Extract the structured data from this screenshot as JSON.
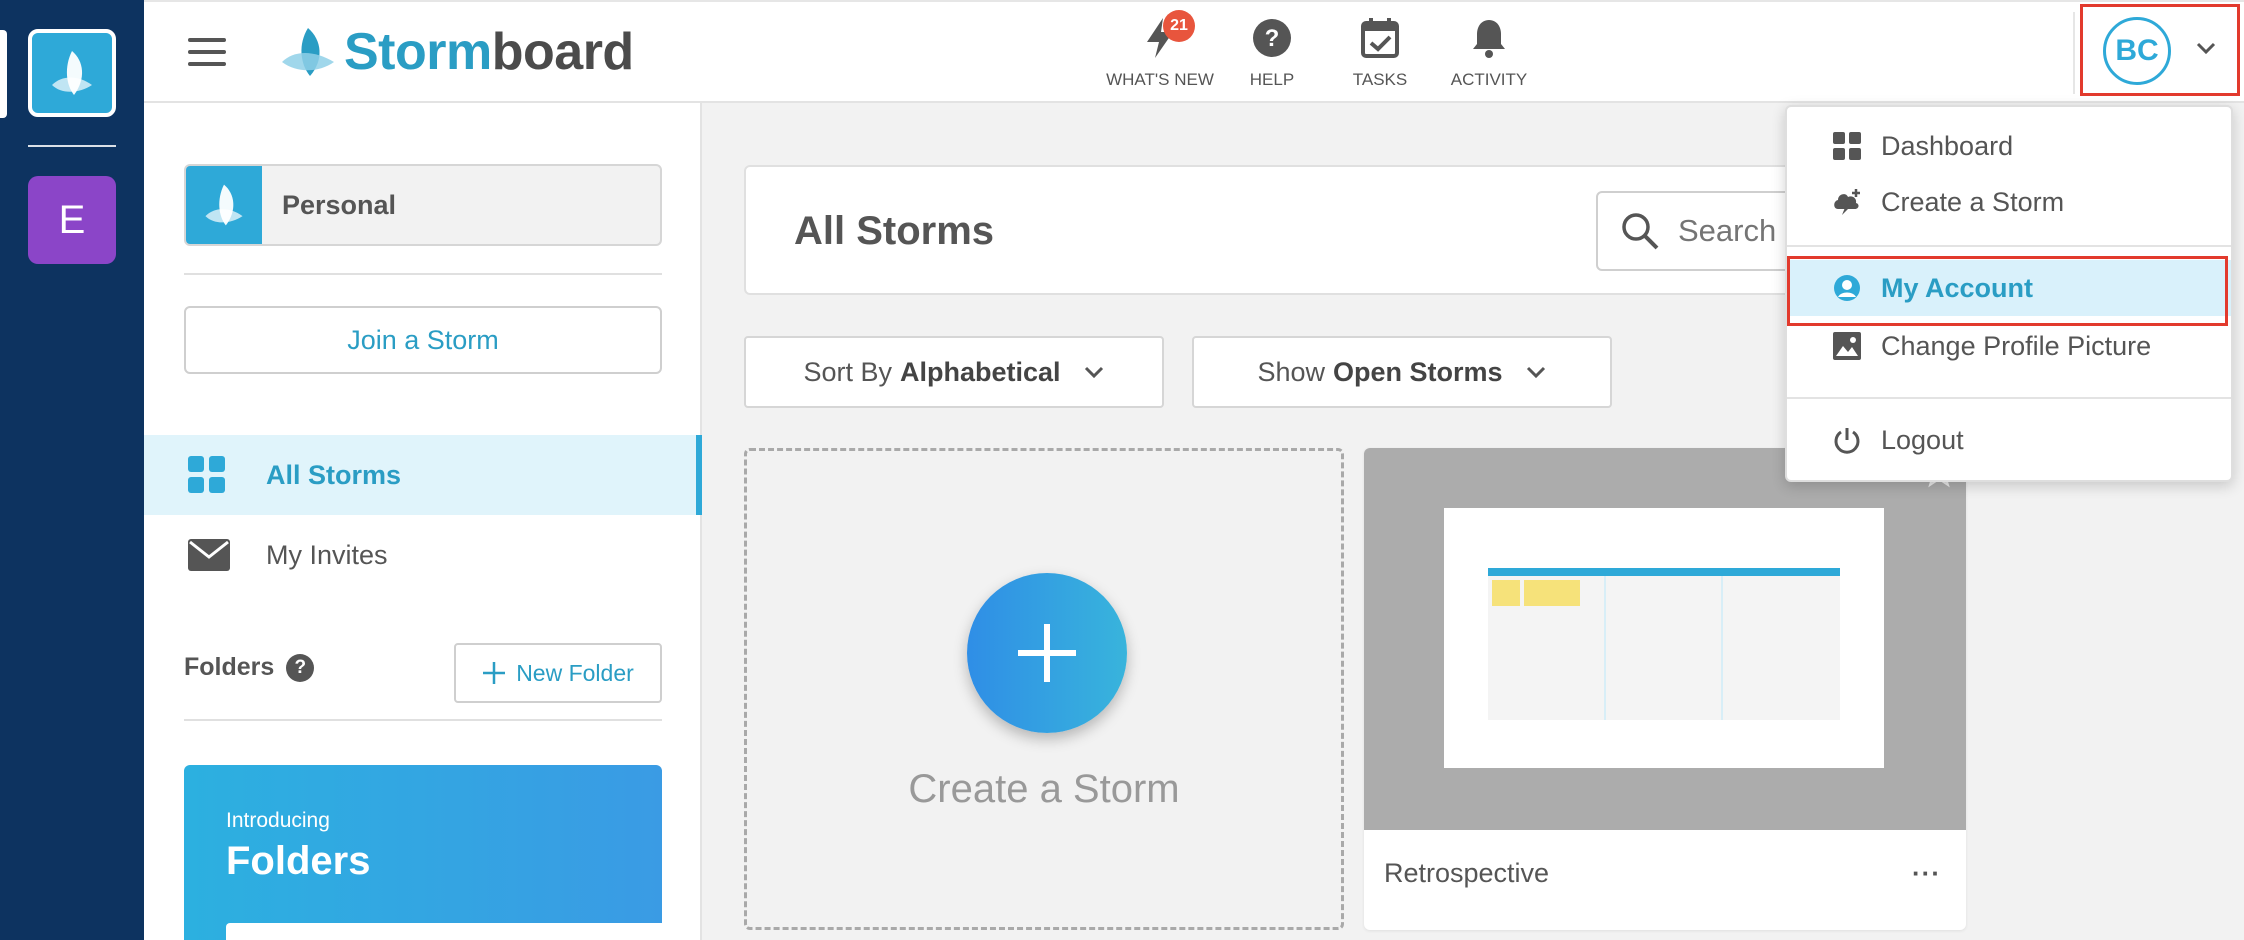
{
  "app": {
    "brand_storm": "Storm",
    "brand_board": "board"
  },
  "rail": {
    "org_letter": "E"
  },
  "header": {
    "whats_new": {
      "label": "WHAT'S NEW",
      "badge": "21"
    },
    "help": {
      "label": "HELP"
    },
    "tasks": {
      "label": "TASKS"
    },
    "activity": {
      "label": "ACTIVITY"
    },
    "avatar_initials": "BC"
  },
  "sidebar": {
    "workspace": "Personal",
    "join_button": "Join a Storm",
    "nav": [
      {
        "label": "All Storms",
        "icon": "grid-icon",
        "active": true
      },
      {
        "label": "My Invites",
        "icon": "envelope-icon",
        "active": false
      }
    ],
    "folders_label": "Folders",
    "folders_help": "?",
    "new_folder": "New Folder",
    "promo": {
      "small": "Introducing",
      "large": "Folders"
    }
  },
  "main": {
    "title": "All Storms",
    "search_placeholder": "Search Storms",
    "sort": {
      "prefix": "Sort By",
      "value": "Alphabetical"
    },
    "show": {
      "prefix": "Show",
      "value": "Open Storms"
    },
    "create_card": "Create a Storm",
    "storms": [
      {
        "name": "Retrospective",
        "more": "···"
      }
    ]
  },
  "menu": {
    "items": [
      {
        "label": "Dashboard",
        "icon": "grid-icon"
      },
      {
        "label": "Create a Storm",
        "icon": "storm-plus-icon"
      },
      {
        "label": "My Account",
        "icon": "account-circle-icon",
        "highlighted": true
      },
      {
        "label": "Change Profile Picture",
        "icon": "image-icon"
      },
      {
        "label": "Logout",
        "icon": "power-icon"
      }
    ]
  },
  "colors": {
    "rail": "#0d3360",
    "accent": "#2ea9d8",
    "highlight_border": "#e23a2d",
    "badge": "#e8553d",
    "org_e": "#8b45c8"
  }
}
